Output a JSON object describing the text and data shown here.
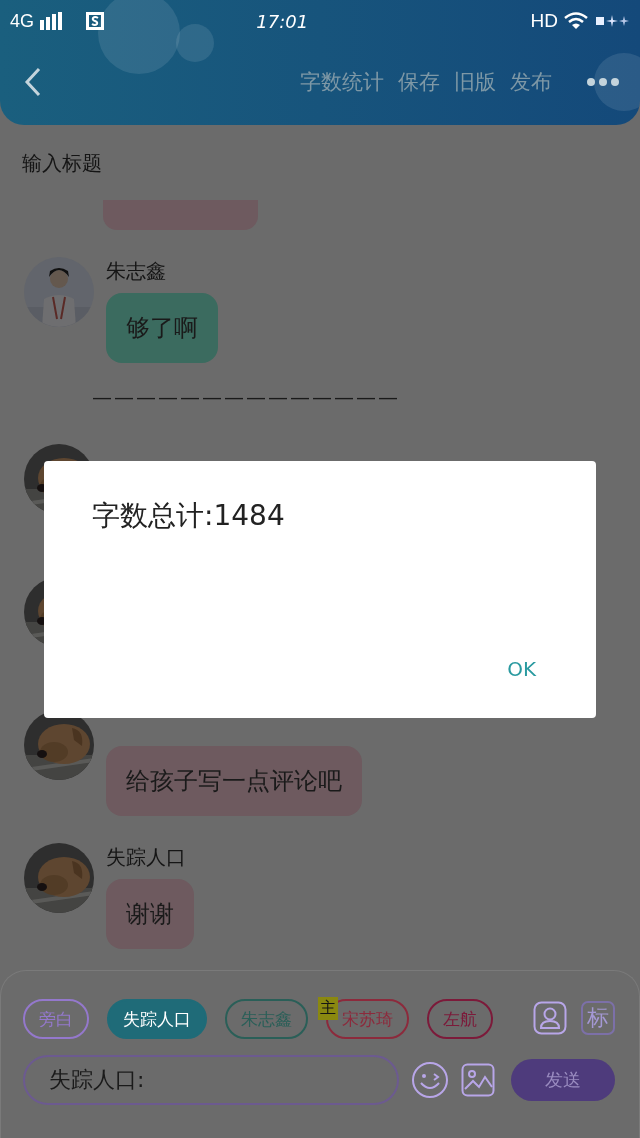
{
  "status_bar": {
    "network": "4G",
    "time": "17:01",
    "hd": "HD"
  },
  "header": {
    "actions": [
      "字数统计",
      "保存",
      "旧版",
      "发布"
    ]
  },
  "title_field": {
    "placeholder": "输入标题"
  },
  "messages": [
    {
      "kind": "partial",
      "color": "#6e5a5f"
    },
    {
      "kind": "person",
      "sender": "朱志鑫",
      "text": "够了啊",
      "color": "#3b6b5f"
    },
    {
      "kind": "divider",
      "text": "——————————————"
    },
    {
      "kind": "dog"
    },
    {
      "kind": "dog"
    },
    {
      "kind": "dog",
      "text": "给孩子写一点评论吧",
      "color": "#6e5a5f"
    },
    {
      "kind": "dog",
      "sender": "失踪人口",
      "text": "谢谢",
      "color": "#6e5a5f"
    }
  ],
  "dialog": {
    "message": "字数总计:1484",
    "button": "OK"
  },
  "composer": {
    "roles": [
      {
        "label": "旁白",
        "color": "#9478cc",
        "selected": false
      },
      {
        "label": "失踪人口",
        "color": "#1f6b78",
        "selected": true
      },
      {
        "label": "朱志鑫",
        "color": "#2a5f58",
        "selected": false
      },
      {
        "label": "宋苏琦",
        "color": "#8c2a3c",
        "selected": false,
        "badge": "主"
      },
      {
        "label": "左航",
        "color": "#7c1a3a",
        "selected": false
      }
    ],
    "tag_label": "标",
    "input": {
      "value": "失踪人口:"
    },
    "send": "发送"
  }
}
